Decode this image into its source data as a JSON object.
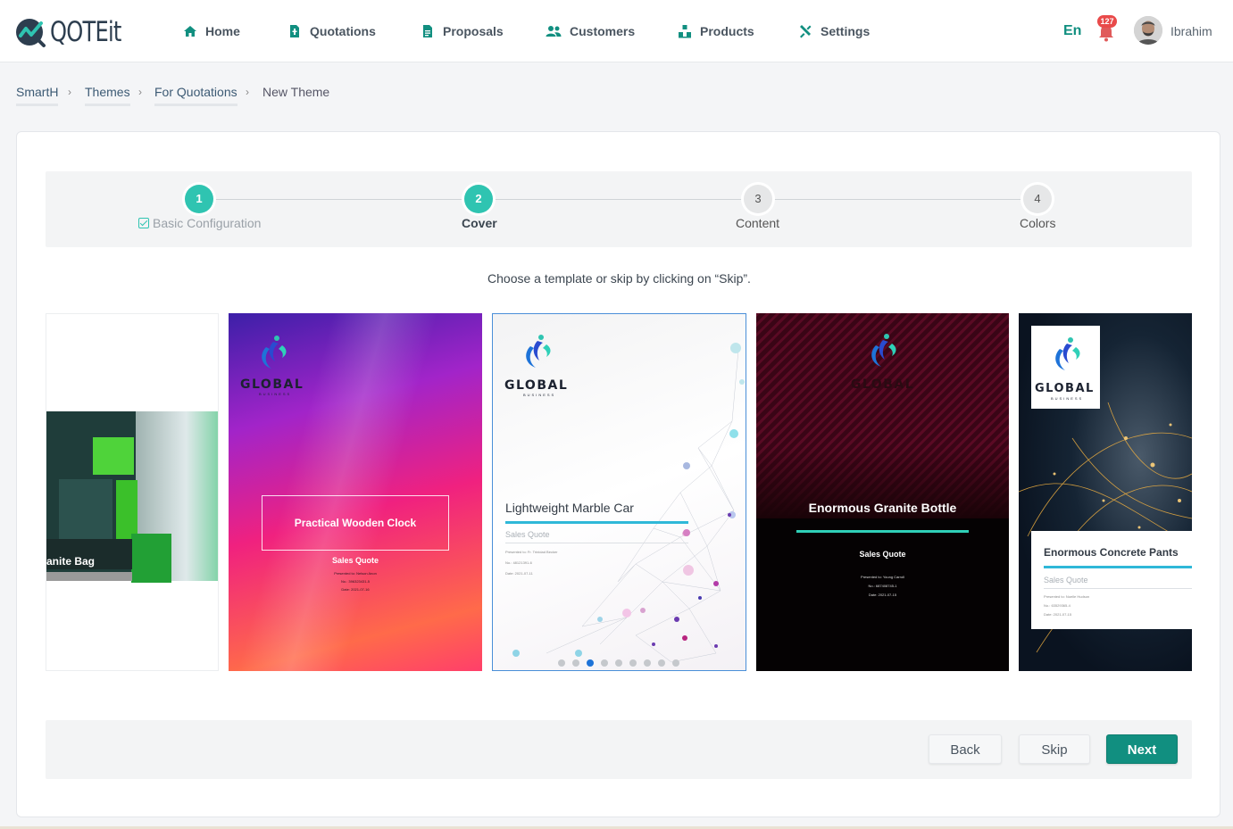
{
  "brand": {
    "logo_text": "QOTEit"
  },
  "nav": {
    "items": [
      {
        "label": "Home",
        "icon": "home-icon"
      },
      {
        "label": "Quotations",
        "icon": "quotation-doc-icon"
      },
      {
        "label": "Proposals",
        "icon": "proposal-doc-icon"
      },
      {
        "label": "Customers",
        "icon": "customers-icon"
      },
      {
        "label": "Products",
        "icon": "products-icon"
      },
      {
        "label": "Settings",
        "icon": "settings-tools-icon"
      }
    ]
  },
  "header": {
    "language": "En",
    "notifications_count": "127",
    "user_name": "Ibrahim"
  },
  "breadcrumb": {
    "items": [
      "SmartH",
      "Themes",
      "For Quotations",
      "New Theme"
    ]
  },
  "stepper": {
    "steps": [
      {
        "number": "1",
        "label": "Basic Configuration",
        "state": "done"
      },
      {
        "number": "2",
        "label": "Cover",
        "state": "active"
      },
      {
        "number": "3",
        "label": "Content",
        "state": "todo"
      },
      {
        "number": "4",
        "label": "Colors",
        "state": "todo"
      }
    ]
  },
  "instruction": "Choose a template or skip by clicking on “Skip”.",
  "templates": {
    "partial_left_title": "anite Bag",
    "brand_name": "GLOBAL",
    "brand_sub": "BUSINESS",
    "cards": [
      {
        "title": "Practical Wooden Clock",
        "subtitle": "Sales Quote",
        "lines": [
          "Presented to: Nelson Anon",
          "No.: 396323431-5",
          "Date: 2021-07-16"
        ]
      },
      {
        "title": "Lightweight Marble Car",
        "subtitle": "Sales Quote",
        "lines": [
          "Presented to: Fr. Trinidad Becker",
          "No.: 48121391-6",
          "Date: 2021-07-11"
        ]
      },
      {
        "title": "Enormous Granite Bottle",
        "subtitle": "Sales Quote",
        "lines": [
          "Presented to: Young Carroll",
          "No.: 687408745-1",
          "Date: 2021-07-15"
        ]
      },
      {
        "title": "Enormous Concrete Pants",
        "subtitle": "Sales Quote",
        "lines": [
          "Presented to: Noelle Hudson",
          "No.: 63529365-4",
          "Date: 2021-07-15"
        ]
      }
    ],
    "dot_count": 9,
    "active_dot": 3
  },
  "footer": {
    "back_label": "Back",
    "skip_label": "Skip",
    "next_label": "Next"
  },
  "colors": {
    "accent": "#118f80",
    "step_accent": "#2fc4b1",
    "selected_border": "#4a8fd8",
    "badge": "#e94a4a"
  }
}
